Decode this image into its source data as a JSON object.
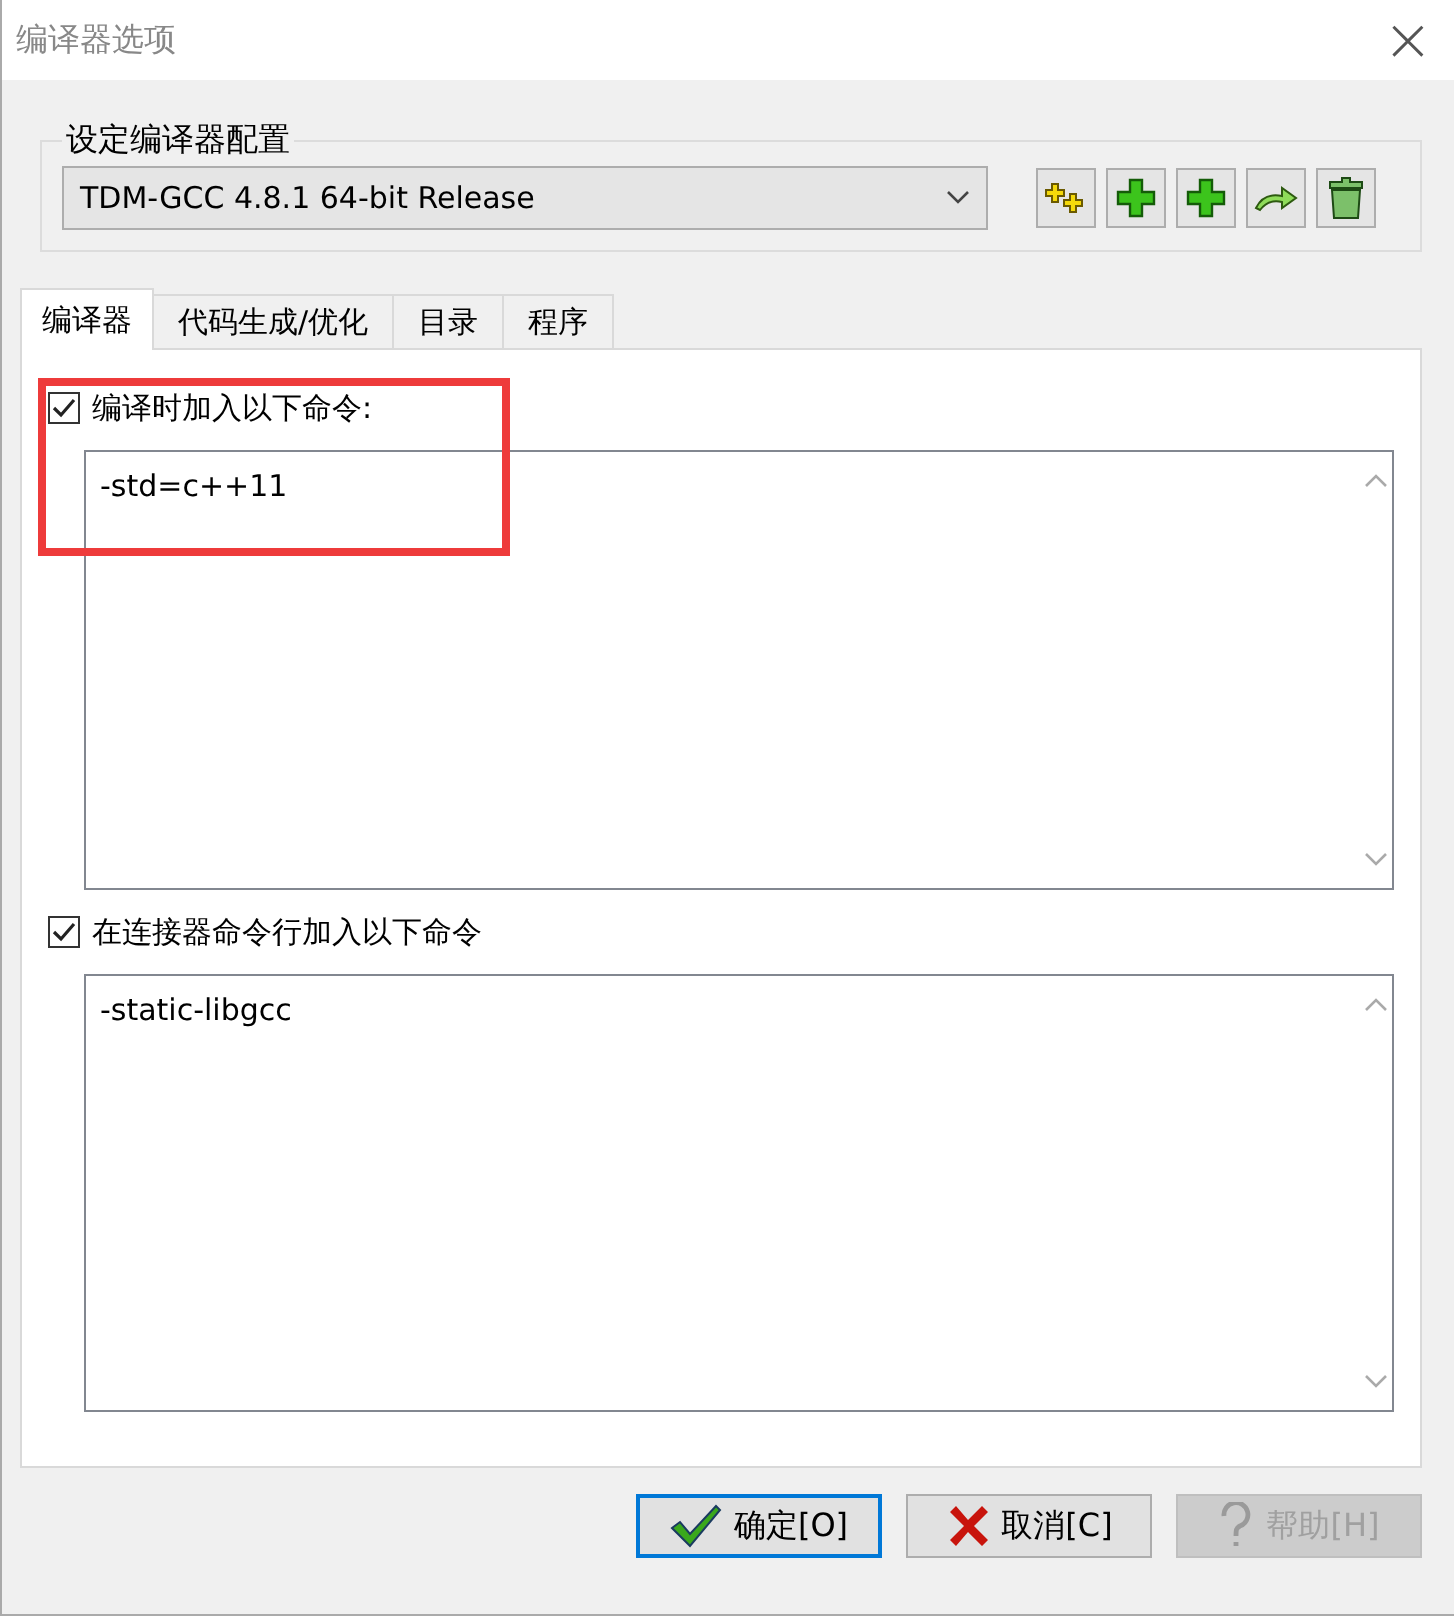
{
  "window": {
    "title": "编译器选项",
    "close": "×"
  },
  "config": {
    "label": "设定编译器配置",
    "value": "TDM-GCC 4.8.1 64-bit Release",
    "tools": [
      {
        "kind": "rename"
      },
      {
        "kind": "add"
      },
      {
        "kind": "add"
      },
      {
        "kind": "export"
      },
      {
        "kind": "delete"
      }
    ]
  },
  "tabs": [
    {
      "label": "编译器",
      "selected": true
    },
    {
      "label": "代码生成/优化",
      "selected": false
    },
    {
      "label": "目录",
      "selected": false
    },
    {
      "label": "程序",
      "selected": false
    }
  ],
  "options": [
    {
      "label": "编译时加入以下命令:",
      "checked": true,
      "value": "-std=c++11",
      "highlighted": true
    },
    {
      "label": "在连接器命令行加入以下命令",
      "checked": true,
      "value": "-static-libgcc",
      "highlighted": false
    }
  ],
  "buttons": [
    {
      "kind": "ok",
      "label": "确定[O]",
      "disabled": false,
      "default": true
    },
    {
      "kind": "cancel",
      "label": "取消[C]",
      "disabled": false,
      "default": false
    },
    {
      "kind": "help",
      "label": "帮助[H]",
      "disabled": true,
      "default": false
    }
  ]
}
